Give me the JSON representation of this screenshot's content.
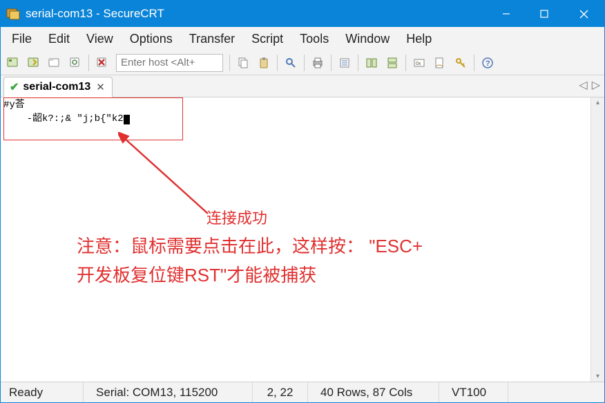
{
  "window": {
    "title": "serial-com13 - SecureCRT"
  },
  "menu": {
    "file": "File",
    "edit": "Edit",
    "view": "View",
    "options": "Options",
    "transfer": "Transfer",
    "script": "Script",
    "tools": "Tools",
    "window": "Window",
    "help": "Help"
  },
  "toolbar": {
    "host_placeholder": "Enter host <Alt+"
  },
  "tab": {
    "label": "serial-com13"
  },
  "terminal": {
    "line1": "#y荅",
    "line2": "    -龆k?:;& \"j;b{\"k2"
  },
  "annotation": {
    "label1": "连接成功",
    "label2_line1": "注意：鼠标需要点击在此，这样按：  \"ESC+",
    "label2_line2": "开发板复位键RST\"才能被捕获"
  },
  "status": {
    "ready": "Ready",
    "serial": "Serial: COM13, 115200",
    "pos": "2,  22",
    "dims": "40 Rows, 87 Cols",
    "emulation": "VT100"
  }
}
